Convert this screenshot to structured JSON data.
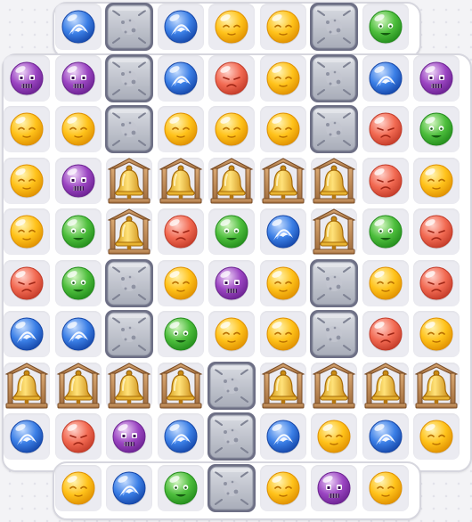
{
  "board": {
    "rows": [
      [
        "none",
        "blue",
        "stone",
        "blue",
        "yellow",
        "yellow",
        "stone",
        "green",
        "none"
      ],
      [
        "purple",
        "purple",
        "stone",
        "blue",
        "red",
        "yellow",
        "stone",
        "blue",
        "purple"
      ],
      [
        "yellow",
        "yellow",
        "stone",
        "yellow",
        "yellow",
        "yellow",
        "stone",
        "red",
        "green"
      ],
      [
        "yellow",
        "purple",
        "bell",
        "bell",
        "bell",
        "bell",
        "bell",
        "red",
        "yellow"
      ],
      [
        "yellow",
        "green",
        "bell",
        "red",
        "green",
        "blue",
        "bell",
        "green",
        "red"
      ],
      [
        "red",
        "green",
        "stone",
        "yellow",
        "purple",
        "yellow",
        "stone",
        "yellow",
        "red"
      ],
      [
        "blue",
        "blue",
        "stone",
        "green",
        "yellow",
        "yellow",
        "stone",
        "red",
        "yellow"
      ],
      [
        "bell",
        "bell",
        "bell",
        "bell",
        "stone",
        "bell",
        "bell",
        "bell",
        "bell"
      ],
      [
        "blue",
        "red",
        "purple",
        "blue",
        "stone",
        "blue",
        "yellow",
        "blue",
        "yellow"
      ],
      [
        "none",
        "yellow",
        "blue",
        "green",
        "stone",
        "yellow",
        "purple",
        "yellow",
        "none"
      ]
    ]
  },
  "piece_types": {
    "red": {
      "icon": "red-drop-icon",
      "colors": [
        "#ffd0c8",
        "#f26a52",
        "#c23a28"
      ]
    },
    "yellow": {
      "icon": "yellow-drop-icon",
      "colors": [
        "#fff3b0",
        "#ffc21a",
        "#df9000"
      ]
    },
    "blue": {
      "icon": "blue-drop-icon",
      "colors": [
        "#c4dcff",
        "#3b7fe6",
        "#1546a8"
      ]
    },
    "green": {
      "icon": "green-drop-icon",
      "colors": [
        "#d4f6c2",
        "#4dbe3c",
        "#238c1c"
      ]
    },
    "purple": {
      "icon": "purple-drop-icon",
      "colors": [
        "#ecd2f6",
        "#9b45c2",
        "#6b2291"
      ]
    },
    "stone": {
      "icon": "stone-block-icon"
    },
    "bell": {
      "icon": "bell-block-icon"
    }
  }
}
